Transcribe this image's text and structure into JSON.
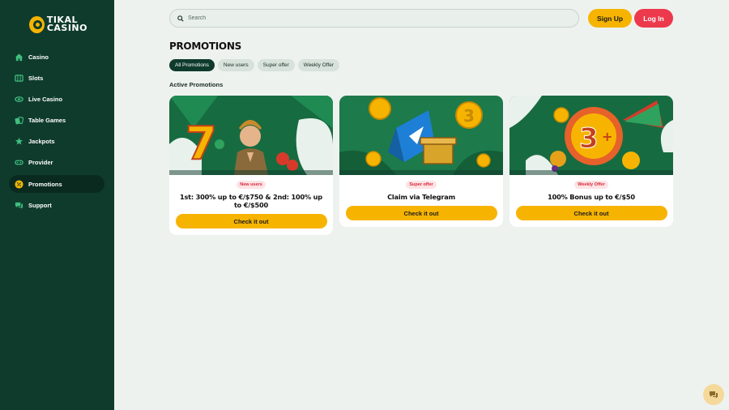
{
  "brand": {
    "line1": "TIKAL",
    "line2": "CASINO",
    "accent": "#f6b400",
    "sidebar_bg": "#0f3b2d"
  },
  "sidebar": {
    "items": [
      {
        "label": "Casino",
        "icon": "home-icon"
      },
      {
        "label": "Slots",
        "icon": "slot-machine-icon"
      },
      {
        "label": "Live Casino",
        "icon": "live-casino-icon"
      },
      {
        "label": "Table Games",
        "icon": "cards-icon"
      },
      {
        "label": "Jackpots",
        "icon": "star-burst-icon"
      },
      {
        "label": "Provider",
        "icon": "gamepad-icon"
      },
      {
        "label": "Promotions",
        "icon": "percent-icon",
        "active": true
      },
      {
        "label": "Support",
        "icon": "chat-icon"
      }
    ]
  },
  "header": {
    "search_placeholder": "Search",
    "signup_label": "Sign Up",
    "login_label": "Log In"
  },
  "main": {
    "title": "PROMOTIONS",
    "filters": [
      {
        "label": "All Promotions",
        "active": true
      },
      {
        "label": "New users"
      },
      {
        "label": "Super offer"
      },
      {
        "label": "Weekly Offer"
      }
    ],
    "section_title": "Active Promotions",
    "cards": [
      {
        "badge": "New users",
        "title": "1st: 300% up to €/$750 & 2nd: 100% up to €/$500",
        "button": "Check it out"
      },
      {
        "badge": "Super offer",
        "title": "Claim via Telegram",
        "button": "Check it out"
      },
      {
        "badge": "Weekly Offer",
        "title": "100% Bonus up to €/$50",
        "button": "Check it out"
      }
    ]
  }
}
